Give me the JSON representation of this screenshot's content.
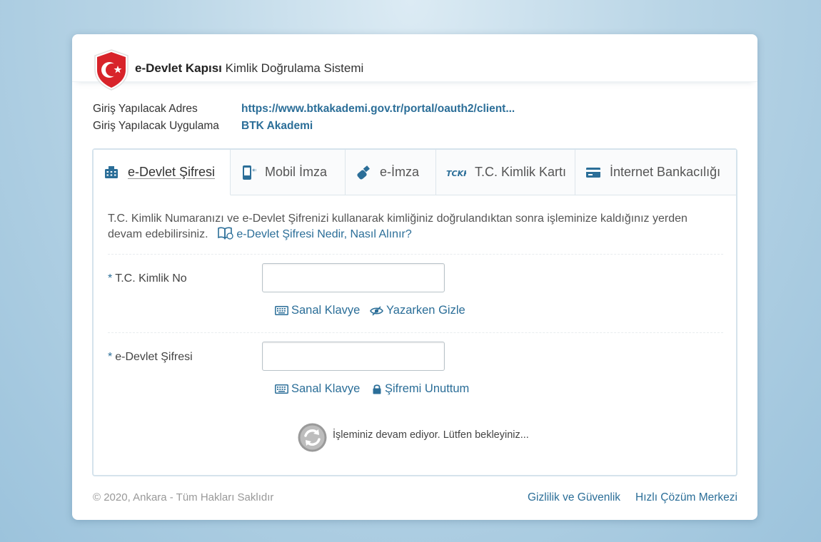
{
  "header": {
    "brand_bold": "e-Devlet Kapısı",
    "brand_rest": "Kimlik Doğrulama Sistemi"
  },
  "info": {
    "address_label": "Giriş Yapılacak Adres",
    "address_value": "https://www.btkakademi.gov.tr/portal/oauth2/client...",
    "app_label": "Giriş Yapılacak Uygulama",
    "app_value": "BTK Akademi"
  },
  "tabs": [
    {
      "label": "e-Devlet Şifresi",
      "icon": "keypad-icon",
      "active": true
    },
    {
      "label": "Mobil İmza",
      "icon": "mobile-signature-icon",
      "active": false
    },
    {
      "label": "e-İmza",
      "icon": "usb-token-icon",
      "active": false
    },
    {
      "label": "T.C. Kimlik Kartı",
      "icon": "tckk-icon",
      "active": false
    },
    {
      "label": "İnternet Bankacılığı",
      "icon": "bank-card-icon",
      "active": false
    }
  ],
  "form": {
    "description": "T.C. Kimlik Numaranızı ve e-Devlet Şifrenizi kullanarak kimliğiniz doğrulandıktan sonra işleminize kaldığınız yerden devam edebilirsiniz.",
    "help_link": "e-Devlet Şifresi Nedir, Nasıl Alınır?",
    "required_mark": "*",
    "tc_label": "T.C. Kimlik No",
    "tc_value": "",
    "password_label": "e-Devlet Şifresi",
    "password_value": "",
    "virtual_keyboard": "Sanal Klavye",
    "hide_typing": "Yazarken Gizle",
    "forgot_password": "Şifremi Unuttum",
    "loading_text": "İşleminiz devam ediyor. Lütfen bekleyiniz..."
  },
  "footer": {
    "copyright": "© 2020, Ankara - Tüm Hakları Saklıdır",
    "privacy": "Gizlilik ve Güvenlik",
    "help_center": "Hızlı Çözüm Merkezi"
  },
  "colors": {
    "accent": "#2b6e98",
    "logo_red": "#d8232a",
    "text": "#444444",
    "panel_border": "#d5e3ec"
  }
}
